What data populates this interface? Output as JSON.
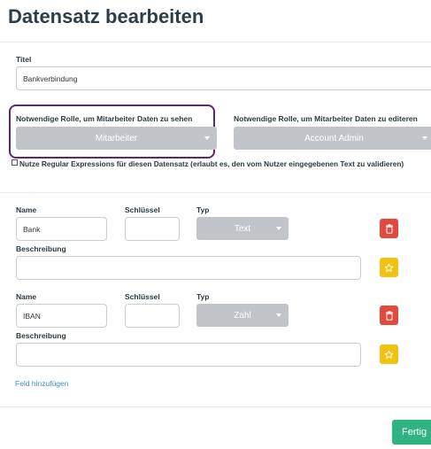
{
  "page": {
    "title": "Datensatz bearbeiten"
  },
  "titel_field": {
    "label": "Titel",
    "value": "Bankverbindung"
  },
  "roles": {
    "view": {
      "label": "Notwendige Rolle, um Mitarbeiter Daten zu sehen",
      "selected": "Mitarbeiter"
    },
    "edit": {
      "label": "Notwendige Rolle, um Mitarbeiter Daten zu editeren",
      "selected": "Account Admin"
    }
  },
  "regex_option": {
    "label": "Nutze Regular Expressions für diesen Datensatz (erlaubt es, den vom Nutzer eingegebenen Text zu validieren)",
    "checked": false
  },
  "fields": [
    {
      "name_label": "Name",
      "name_value": "Bank",
      "key_label": "Schlüssel",
      "key_value": "",
      "type_label": "Typ",
      "type_value": "Text",
      "description_label": "Beschreibung",
      "description_value": ""
    },
    {
      "name_label": "Name",
      "name_value": "IBAN",
      "key_label": "Schlüssel",
      "key_value": "",
      "type_label": "Typ",
      "type_value": "Zahl",
      "description_label": "Beschreibung",
      "description_value": ""
    }
  ],
  "add_field_link": "Feld hinzufügen",
  "done_button": "Fertig",
  "icons": {
    "delete": "trash-icon",
    "favorite": "star-icon"
  },
  "colors": {
    "delete": "#e04a3f",
    "favorite": "#f2c114",
    "done": "#2fb382",
    "link": "#3d8fd1",
    "highlight": "#5b2a6e",
    "select": "#c1c5c9"
  }
}
